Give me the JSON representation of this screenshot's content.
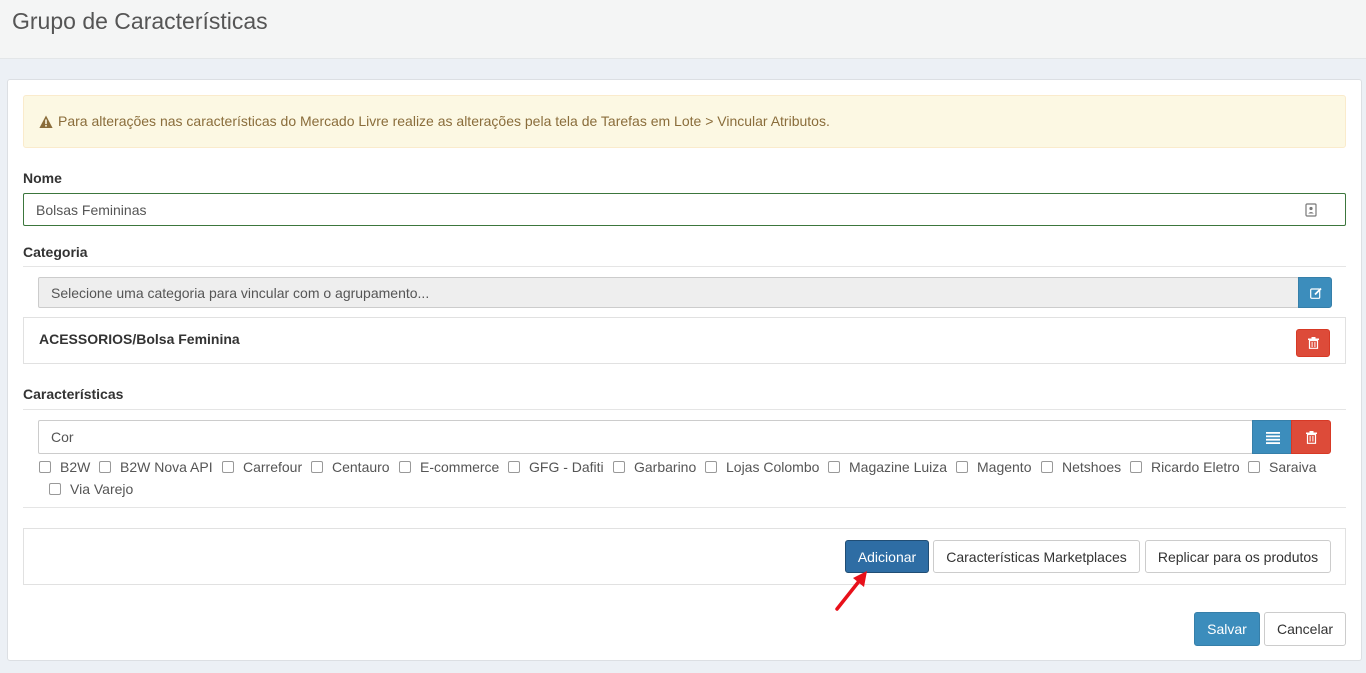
{
  "header": {
    "title": "Grupo de Características"
  },
  "alert": {
    "text": "Para alterações nas características do Mercado Livre realize as alterações pela tela de Tarefas em Lote > Vincular Atributos."
  },
  "nome": {
    "label": "Nome",
    "value": "Bolsas Femininas"
  },
  "categoria": {
    "label": "Categoria",
    "placeholder": "Selecione uma categoria para vincular com o agrupamento...",
    "selected": "ACESSORIOS/Bolsa Feminina"
  },
  "caracteristicas": {
    "label": "Características",
    "value": "Cor",
    "marketplaces": [
      "B2W",
      "B2W Nova API",
      "Carrefour",
      "Centauro",
      "E-commerce",
      "GFG - Dafiti",
      "Garbarino",
      "Lojas Colombo",
      "Magazine Luiza",
      "Magento",
      "Netshoes",
      "Ricardo Eletro",
      "Saraiva",
      "Via Varejo"
    ]
  },
  "actions": {
    "adicionar": "Adicionar",
    "marketplaces": "Características Marketplaces",
    "replicar": "Replicar para os produtos",
    "salvar": "Salvar",
    "cancelar": "Cancelar"
  },
  "colors": {
    "primary": "#3c8dbc",
    "danger": "#dd4b39",
    "warning_bg": "#fcf8e3",
    "success_border": "#3c763d",
    "annotation_arrow": "#e8101a"
  },
  "icons": {
    "alert": "warning-icon",
    "nome_field": "contact-card-icon",
    "categoria_edit": "edit-icon",
    "categoria_delete": "trash-icon",
    "list": "list-icon",
    "delete": "trash-icon"
  }
}
